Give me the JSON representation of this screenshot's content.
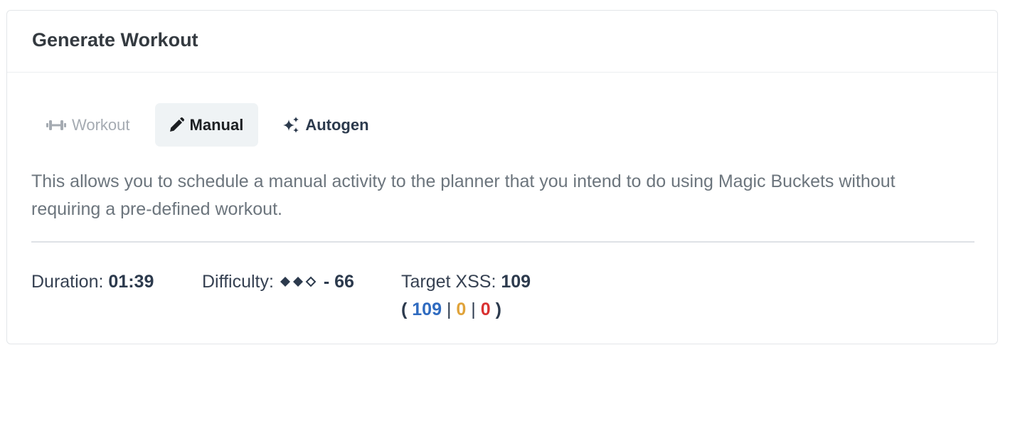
{
  "header": {
    "title": "Generate Workout"
  },
  "tabs": [
    {
      "label": "Workout",
      "icon": "dumbbell-icon",
      "active": false
    },
    {
      "label": "Manual",
      "icon": "pencil-icon",
      "active": true
    },
    {
      "label": "Autogen",
      "icon": "sparkles-icon",
      "active": false
    }
  ],
  "description": "This allows you to schedule a manual activity to the planner that you intend to do using Magic Buckets without requiring a pre-defined workout.",
  "stats": {
    "duration_label": "Duration:",
    "duration_value": "01:39",
    "difficulty_label": "Difficulty:",
    "difficulty_value": "- 66",
    "difficulty_level": {
      "filled": 2,
      "total": 3
    },
    "xss_label": "Target XSS:",
    "xss_value": "109",
    "xss_breakdown": {
      "open": "(",
      "close": ")",
      "separator": "|",
      "values": [
        {
          "value": "109",
          "color": "#2f6bc0"
        },
        {
          "value": "0",
          "color": "#e0a33a"
        },
        {
          "value": "0",
          "color": "#d93131"
        }
      ]
    }
  },
  "colors": {
    "tab_active_bg": "#eff3f5",
    "divider": "#dee2e6",
    "text_muted": "#6c757d"
  }
}
